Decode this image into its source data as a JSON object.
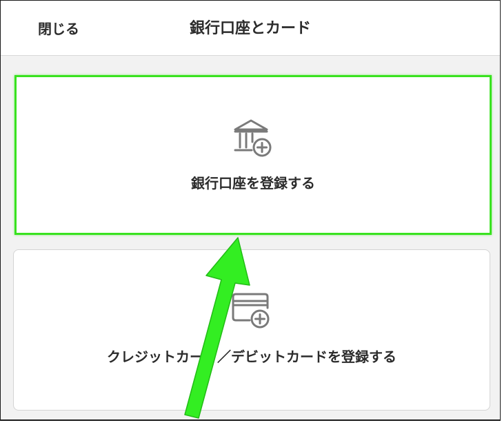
{
  "header": {
    "close_label": "閉じる",
    "title": "銀行口座とカード"
  },
  "options": {
    "bank": {
      "label": "銀行口座を登録する",
      "icon": "bank-add-icon"
    },
    "credit": {
      "label": "クレジットカード／デビットカードを登録する",
      "icon": "card-add-icon"
    }
  },
  "colors": {
    "highlight": "#39e21f",
    "icon": "#7a7a7a",
    "text": "#2b2b2b"
  }
}
